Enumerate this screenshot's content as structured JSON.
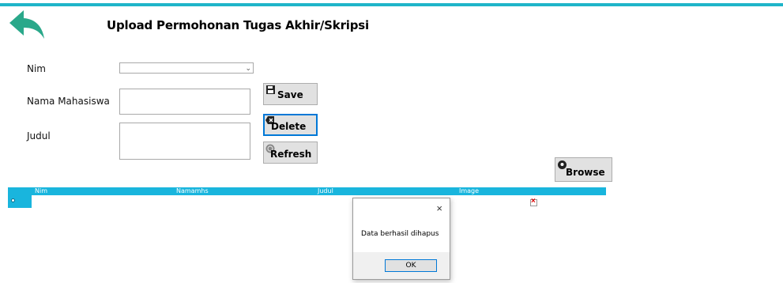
{
  "header": {
    "title": "Upload Permohonan Tugas Akhir/Skripsi"
  },
  "form": {
    "nim_label": "Nim",
    "nim_value": "",
    "nama_label": "Nama Mahasiswa",
    "nama_value": "",
    "judul_label": "Judul",
    "judul_value": ""
  },
  "buttons": {
    "save": "Save",
    "delete": "Delete",
    "refresh": "Refresh",
    "browse": "Browse"
  },
  "grid": {
    "columns": [
      "Nim",
      "Namamhs",
      "Judul",
      "Image"
    ]
  },
  "dialog": {
    "message": "Data berhasil dihapus",
    "ok": "OK",
    "close": "×"
  },
  "icons": {
    "back": "back-arrow-icon",
    "save": "floppy-icon",
    "delete": "delete-icon",
    "refresh": "refresh-icon",
    "browse": "browse-icon",
    "broken_image": "broken-image-icon"
  },
  "colors": {
    "accent": "#1fb5c9",
    "grid_header": "#19b5dd",
    "back_arrow": "#2aa88a"
  }
}
